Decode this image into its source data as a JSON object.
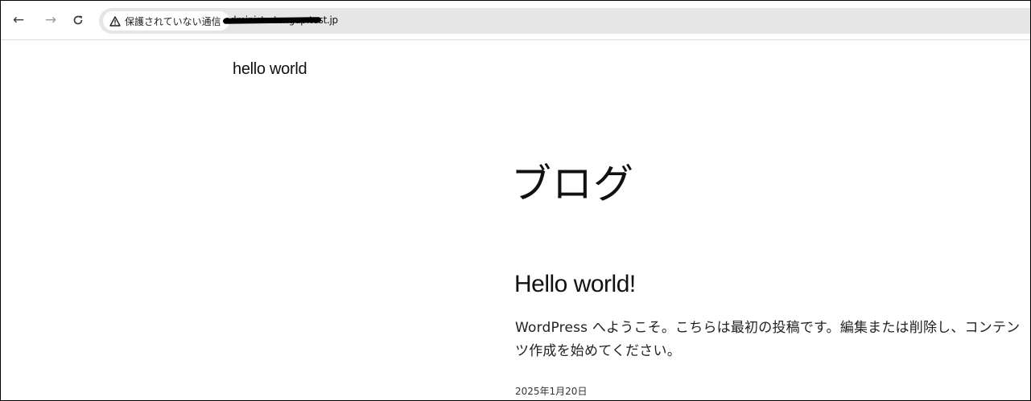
{
  "browser": {
    "security_label": "保護されていない通信",
    "url": "administrator.gup.test.jp",
    "icons": {
      "back": "arrow-left-icon",
      "forward": "arrow-right-icon",
      "reload": "reload-icon",
      "warning": "warning-triangle-icon"
    }
  },
  "site": {
    "title": "hello world"
  },
  "page": {
    "heading": "ブログ"
  },
  "post": {
    "title": "Hello world!",
    "excerpt": "WordPress へようこそ。こちらは最初の投稿です。編集または削除し、コンテンツ作成を始めてください。",
    "date": "2025年1月20日"
  }
}
